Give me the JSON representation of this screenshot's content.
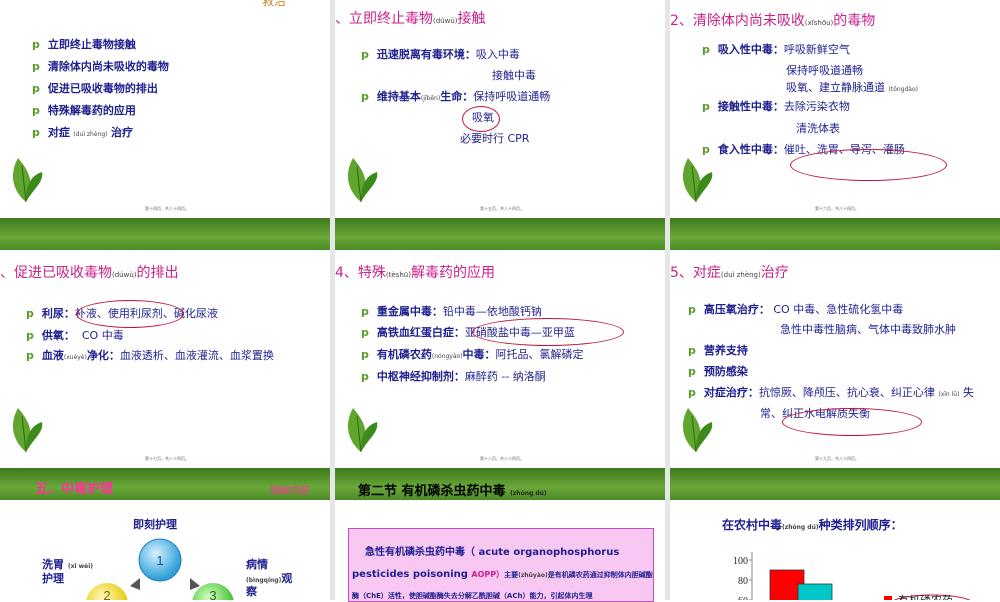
{
  "slide1": {
    "title_fragment": "救治",
    "items": [
      {
        "text": "立即终止毒物接触"
      },
      {
        "text": "清除体内尚未吸收的毒物"
      },
      {
        "text": "促进已吸收毒物的排出"
      },
      {
        "text": "特殊解毒药的应用"
      },
      {
        "text": "对症",
        "py": "(duì zhèng)",
        "text2": "治疗"
      }
    ],
    "footer": "第十四页，共八十四页。"
  },
  "slide2": {
    "title_prefix": "、立即终止毒物",
    "title_py": "(dúwù)",
    "title_suffix": "接触",
    "l1_b": "迅速脱离有毒环境：",
    "l1": "吸入中毒",
    "l2": "接触中毒",
    "l3_b": "维持基本",
    "l3_py": "(jīběn)",
    "l3_b2": "生命：",
    "l3": "保持呼吸道通畅",
    "l4": "吸氧",
    "l5": "必要时行 CPR",
    "footer": "第十五页，共八十四页。"
  },
  "slide3": {
    "title_prefix": "、清除体内尚未吸收",
    "title_py": "(xīshōu)",
    "title_suffix": "的毒物",
    "l1_b": "吸入性中毒：",
    "l1": "呼吸新鲜空气",
    "l2": "保持呼吸道通畅",
    "l3": "吸氧、建立静脉通道",
    "l3_py": "(tōngdào)",
    "l4_b": "接触性中毒：",
    "l4": "去除污染衣物",
    "l5": "清洗体表",
    "l6_b": "食入性中毒：",
    "l6": "催吐、洗胃、导泻、灌肠",
    "footer": "第十六页，共八十四页。"
  },
  "slide4": {
    "title_prefix": "、促进已吸收毒物",
    "title_py": "(dúwù)",
    "title_suffix": "的排出",
    "l1_b": "利尿：",
    "l1": "补液、使用利尿剂、碱化尿液",
    "l2_b": "供氧：",
    "l2": "CO 中毒",
    "l3_b": "血液",
    "l3_py": "(xuèyè)",
    "l3_b2": "净化：",
    "l3": "血液透析、血液灌流、血浆置换",
    "footer": "第十七页，共八十四页。"
  },
  "slide5": {
    "title_num": "4",
    "title_prefix": "、特殊",
    "title_py": "(tèshū)",
    "title_suffix": "解毒药的应用",
    "l1_b": "重金属中毒：",
    "l1": "铅中毒—依地酸钙钠",
    "l2_b": "高铁血红蛋白症：",
    "l2": "亚硝酸盐中毒—亚甲蓝",
    "l3_b": "有机磷农药",
    "l3_py": "(nóngyào)",
    "l3_b2": "中毒：",
    "l3": "阿托品、氯解磷定",
    "l4_b": "中枢神经抑制剂：",
    "l4": "麻醉药 -- 纳洛酮",
    "footer": "第十八页，共八十四页。"
  },
  "slide6": {
    "title_num": "5",
    "title_prefix": "、对症",
    "title_py": "(duì zhèng)",
    "title_suffix": "治疗",
    "l1_b": "高压氧治疗：",
    "l1": "CO 中毒、急性硫化氢中毒",
    "l2": "急性中毒性脑病、气体中毒致肺水肿",
    "l3_b": "营养支持",
    "l4_b": "预防感染",
    "l5_b": "对症治疗：",
    "l5": "抗惊厥、降颅压、抗心衰、纠正心律",
    "l5_py": "(xīn lǜ)",
    "l5_end": "失",
    "l6": "常、纠正水电解质失衡",
    "footer": "第十九页，共八十四页。"
  },
  "slide7": {
    "bar_title": "五、中毒护理",
    "bar_tag": "理解内容",
    "immediate": "即刻护理",
    "wash_1": "洗胃",
    "wash_py": "(xǐ wèi)",
    "wash_2": "护理",
    "obs_1": "病情",
    "obs_py": "(bìngqíng)",
    "obs_2": "观",
    "obs_3": "察",
    "n1": "1",
    "n2": "2",
    "n3": "3"
  },
  "slide8": {
    "bar_title": "第二节  有机磷杀虫药中毒",
    "bar_py": "(zhòng dú)",
    "p1_b": "急性有机磷杀虫药中毒",
    "p1": "（ acute organophosphorus",
    "p2": "pesticides poisoning",
    "p2_m": "AOPP）",
    "p2_b": "主要",
    "p2_py": "(zhǔyào)",
    "p2_b2": "是有机磷农药通过抑制体内胆碱酯",
    "p3": "酶（ChE）活性，使胆碱酯酶失去分解乙酰胆碱（ACh）能力，引起体内生理"
  },
  "slide9": {
    "title": "在农村中毒",
    "title_py": "(zhòng dú)",
    "title_suffix": "种类排列顺序：",
    "legend": "有机磷农药",
    "colors": {
      "bar1": "#ff0000",
      "bar2": "#00c8c8"
    }
  },
  "chart_data": {
    "type": "bar",
    "yticks": [
      100,
      80,
      60
    ],
    "ylim": [
      0,
      100
    ],
    "series": [
      {
        "name": "有机磷农药",
        "values": [
          90
        ]
      },
      {
        "values": [
          76
        ]
      }
    ]
  }
}
